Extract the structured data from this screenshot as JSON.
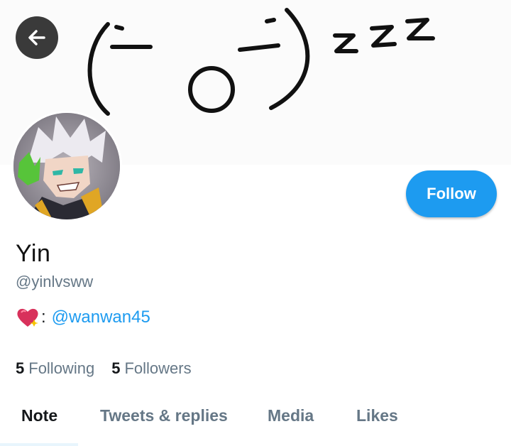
{
  "banner": {
    "doodle_left_paren": "(",
    "doodle_face": "-_o-",
    "doodle_right_paren": ")",
    "doodle_snore": "zzz"
  },
  "profile": {
    "name": "Yin",
    "handle": "@yinlvsww",
    "bio_separator": ":",
    "bio_mention": "@wanwan45",
    "bio_icon": "sparkling-heart-icon"
  },
  "actions": {
    "follow_label": "Follow",
    "back_icon": "back-arrow-icon"
  },
  "stats": {
    "following_count": "5",
    "following_label": "Following",
    "followers_count": "5",
    "followers_label": "Followers"
  },
  "tabs": [
    {
      "label": "Note",
      "active": true
    },
    {
      "label": "Tweets & replies",
      "active": false
    },
    {
      "label": "Media",
      "active": false
    },
    {
      "label": "Likes",
      "active": false
    }
  ],
  "colors": {
    "accent": "#1d9bf0",
    "secondary_text": "#657786",
    "primary_text": "#14171a"
  }
}
